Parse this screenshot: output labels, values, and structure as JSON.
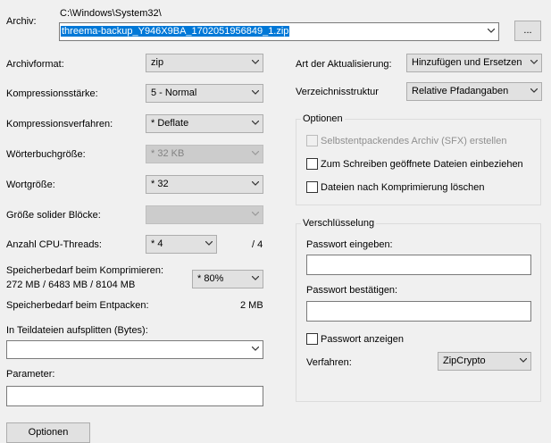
{
  "archive": {
    "label": "Archiv:",
    "path": "C:\\Windows\\System32\\",
    "filename": "threema-backup_Y946X9BA_1702051956849_1.zip",
    "browse_label": "..."
  },
  "left": {
    "format_label": "Archivformat:",
    "format_value": "zip",
    "level_label": "Kompressionsstärke:",
    "level_value": "5 - Normal",
    "method_label": "Kompressionsverfahren:",
    "method_value": "* Deflate",
    "dict_label": "Wörterbuchgröße:",
    "dict_value": "* 32 KB",
    "word_label": "Wortgröße:",
    "word_value": "* 32",
    "solid_label": "Größe solider Blöcke:",
    "solid_value": "",
    "threads_label": "Anzahl CPU-Threads:",
    "threads_value": "* 4",
    "threads_max": "/ 4",
    "mem_compress_label": "Speicherbedarf beim Komprimieren:",
    "mem_compress_value": "272 MB / 6483 MB / 8104 MB",
    "mem_percent": "* 80%",
    "mem_extract_label": "Speicherbedarf beim Entpacken:",
    "mem_extract_value": "2 MB",
    "split_label": "In Teildateien aufsplitten (Bytes):",
    "split_value": "",
    "params_label": "Parameter:",
    "params_value": "",
    "bottom_button_label": "Optionen"
  },
  "right": {
    "update_label": "Art der Aktualisierung:",
    "update_value": "Hinzufügen und Ersetzen",
    "paths_label": "Verzeichnisstruktur",
    "paths_value": "Relative Pfadangaben",
    "options_title": "Optionen",
    "sfx_label": "Selbstentpackendes Archiv (SFX) erstellen",
    "shared_label": "Zum Schreiben geöffnete Dateien einbeziehen",
    "delete_label": "Dateien nach Komprimierung löschen",
    "encryption_title": "Verschlüsselung",
    "password_label": "Passwort eingeben:",
    "password_confirm_label": "Passwort bestätigen:",
    "show_password_label": "Passwort anzeigen",
    "method_label": "Verfahren:",
    "method_value": "ZipCrypto"
  }
}
